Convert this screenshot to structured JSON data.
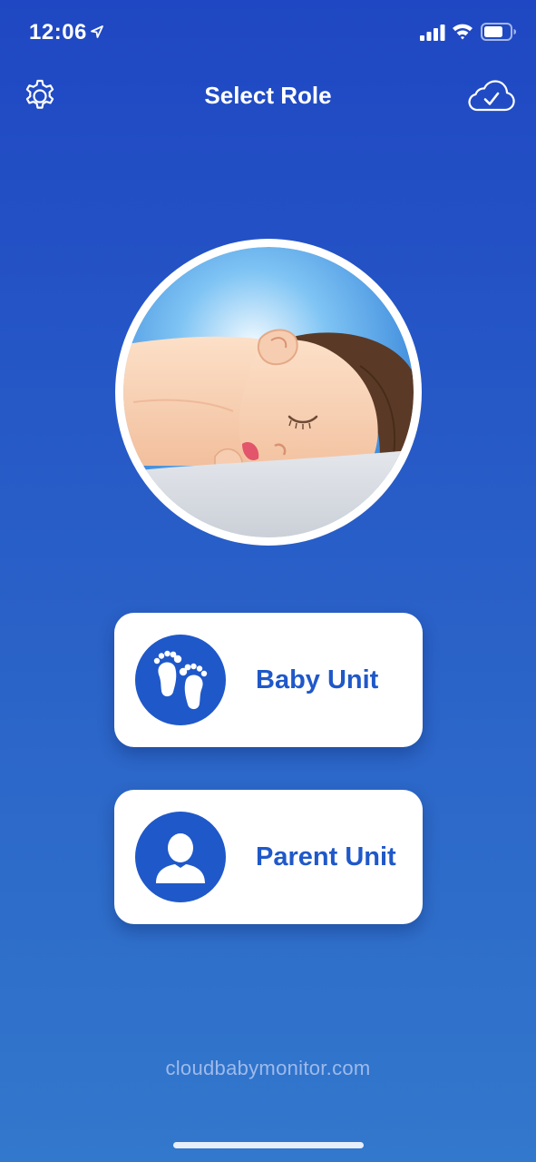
{
  "status_bar": {
    "time": "12:06",
    "icons": [
      "location-arrow-icon",
      "cellular-signal-icon",
      "wifi-icon",
      "battery-icon"
    ]
  },
  "nav": {
    "title": "Select Role",
    "left_icon": "gear-icon",
    "right_icon": "cloud-check-icon"
  },
  "hero": {
    "image": "sleeping-baby-illustration"
  },
  "roles": [
    {
      "label": "Baby Unit",
      "icon": "baby-footprints-icon"
    },
    {
      "label": "Parent Unit",
      "icon": "person-icon"
    }
  ],
  "footer": {
    "website": "cloudbabymonitor.com"
  },
  "colors": {
    "background": "#2458c6",
    "accent": "#1f58c9",
    "card": "#ffffff"
  }
}
